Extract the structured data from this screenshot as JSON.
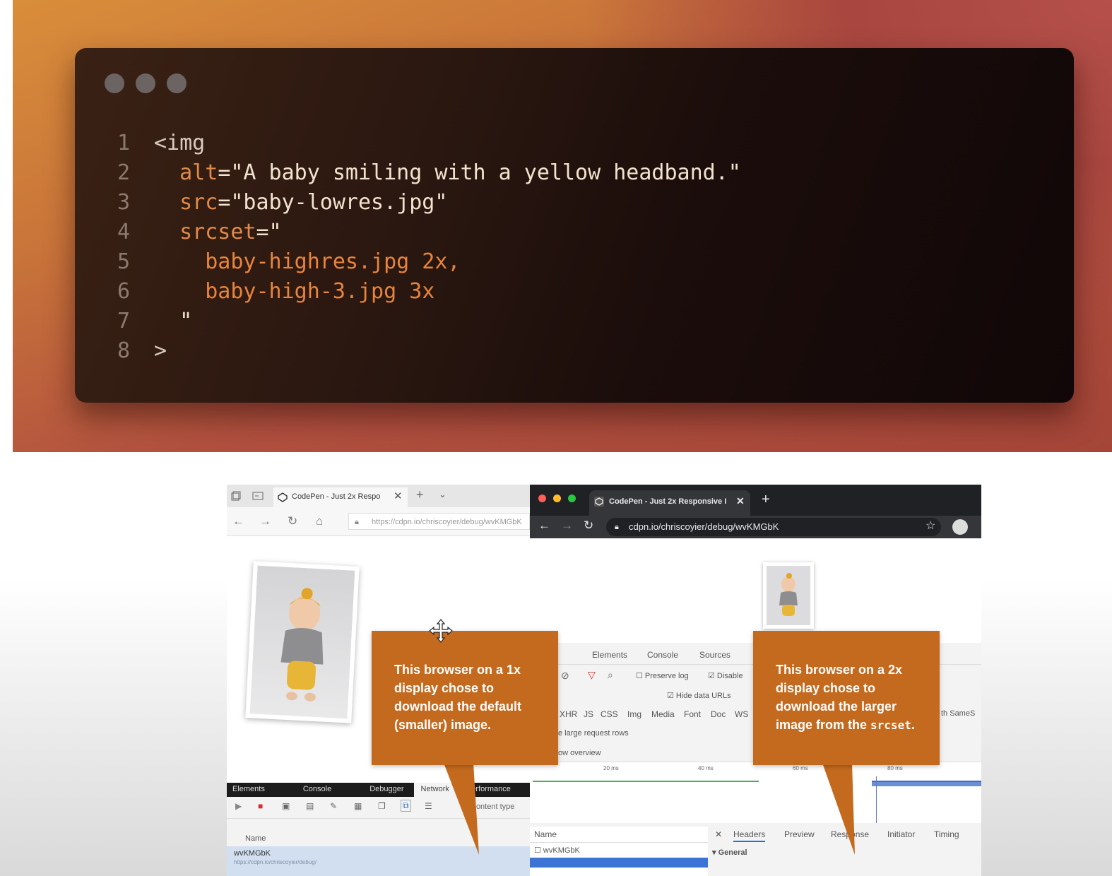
{
  "slide": {
    "code_lines": [
      {
        "n": "1",
        "tokens": [
          {
            "t": "<img",
            "c": "punct"
          }
        ]
      },
      {
        "n": "2",
        "tokens": [
          {
            "t": "  "
          },
          {
            "t": "alt",
            "c": "attr"
          },
          {
            "t": "=\"A baby smiling with a yellow headband.\"",
            "c": "str"
          }
        ]
      },
      {
        "n": "3",
        "tokens": [
          {
            "t": "  "
          },
          {
            "t": "src",
            "c": "attr"
          },
          {
            "t": "=\"baby-lowres.jpg\"",
            "c": "str"
          }
        ]
      },
      {
        "n": "4",
        "tokens": [
          {
            "t": "  "
          },
          {
            "t": "srcset",
            "c": "attr"
          },
          {
            "t": "=\"",
            "c": "str"
          }
        ]
      },
      {
        "n": "5",
        "tokens": [
          {
            "t": "    "
          },
          {
            "t": "baby-highres.jpg 2x,",
            "c": "val"
          }
        ]
      },
      {
        "n": "6",
        "tokens": [
          {
            "t": "    "
          },
          {
            "t": "baby-high-3.jpg 3x",
            "c": "val"
          }
        ]
      },
      {
        "n": "7",
        "tokens": [
          {
            "t": "  "
          },
          {
            "t": "\"",
            "c": "str"
          }
        ]
      },
      {
        "n": "8",
        "tokens": [
          {
            "t": ">",
            "c": "punct"
          }
        ]
      }
    ],
    "colors": {
      "attr": "#e08a4a",
      "string": "#f2e3cf",
      "value": "#e8843c",
      "punct": "#d9ccbf"
    }
  },
  "left_browser": {
    "tab_title": "CodePen - Just 2x Respo",
    "url": "https://cdpn.io/chriscoyier/debug/wvKMGbK",
    "devtools_tabs": [
      "Elements",
      "Console",
      "Debugger",
      "Network",
      "Performance"
    ],
    "active_tab": "Network",
    "content_type_label": "Content type",
    "name_header": "Name",
    "row_name": "wvKMGbK",
    "row_url": "https://cdpn.io/chriscoyier/debug/"
  },
  "right_browser": {
    "tab_title": "CodePen - Just 2x Responsive I",
    "url": "cdpn.io/chriscoyier/debug/wvKMGbK",
    "devtools_tabs": [
      "Elements",
      "Console",
      "Sources"
    ],
    "preserve_log": "Preserve log",
    "disable_cache": "Disable",
    "hide_data_urls": "Hide data URLs",
    "filters": [
      "XHR",
      "JS",
      "CSS",
      "Img",
      "Media",
      "Font",
      "Doc",
      "WS"
    ],
    "same_site": "th SameS",
    "large_rows": "e large request rows",
    "overview": "ow overview",
    "ticks": [
      "20 ms",
      "40 ms",
      "60 ms",
      "80 ms"
    ],
    "name_header": "Name",
    "row_name": "wvKMGbK",
    "header_tabs": [
      "Headers",
      "Preview",
      "Response",
      "Initiator",
      "Timing"
    ],
    "general": "General"
  },
  "callouts": {
    "left": [
      "This browser on a 1x",
      "display chose to",
      "download the default",
      "(smaller) image."
    ],
    "right": [
      "This browser on a 2x",
      "display chose to",
      "download the larger",
      "image from the "
    ],
    "right_code": "srcset",
    "right_end": "."
  }
}
